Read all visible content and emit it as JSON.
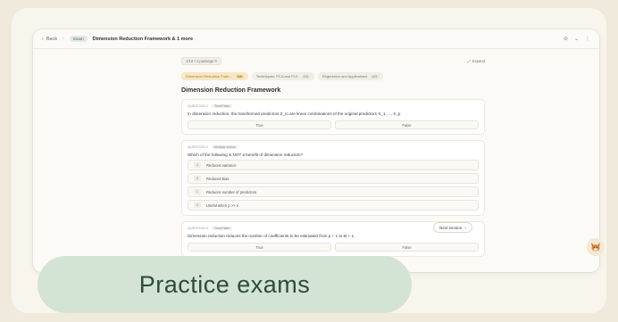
{
  "topbar": {
    "back_label": "Back",
    "badge": "Exam",
    "title": "Dimension Reduction Framework & 1 more"
  },
  "toolbar": {
    "pager": "1/12 • 1 passage 9",
    "expand_label": "Expand"
  },
  "chips": [
    {
      "label": "Dimension Reduction Fram...",
      "count": "5/6"
    },
    {
      "label": "Techniques: PCA and PLS",
      "count": "1/3"
    },
    {
      "label": "Regression and Applications",
      "count": "0/3"
    }
  ],
  "section_title": "Dimension Reduction Framework",
  "questions": [
    {
      "number": "QUESTION 1",
      "type": "True/False",
      "text": "In dimension reduction, the transformed predictors Z_m are linear combinations of the original predictors X_1, ..., X_p",
      "true_label": "True",
      "false_label": "False"
    },
    {
      "number": "QUESTION 2",
      "type": "Multiple choice",
      "text": "Which of the following is NOT a benefit of dimension reduction?",
      "options": [
        {
          "letter": "A",
          "text": "Reduces variance"
        },
        {
          "letter": "B",
          "text": "Reduces bias"
        },
        {
          "letter": "C",
          "text": "Reduces number of predictors"
        },
        {
          "letter": "D",
          "text": "Useful when p >> n"
        }
      ]
    },
    {
      "number": "QUESTION 3",
      "type": "True/False",
      "text": "Dimension reduction reduces the number of coefficients to be estimated from p + 1 to M + 1.",
      "true_label": "True",
      "false_label": "False"
    }
  ],
  "next_button": "Next section",
  "caption": "Practice exams",
  "colors": {
    "background": "#efeadb",
    "pill": "#d3e3d4",
    "pill_text": "#2f4a3b",
    "active_chip": "#f7e7c5"
  }
}
